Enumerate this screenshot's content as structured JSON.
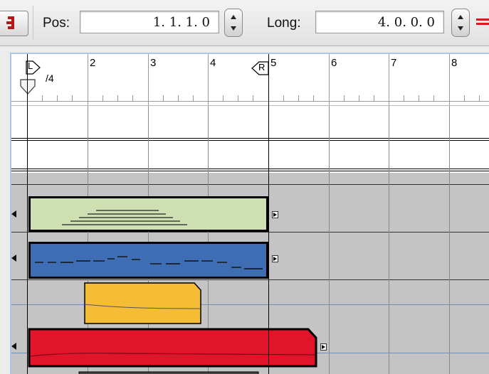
{
  "toolbar": {
    "pos_label": "Pos:",
    "pos_value": "1.  1.  1.    0",
    "long_label": "Long:",
    "long_value": "4.  0.  0.    0"
  },
  "ruler": {
    "signature": "/4",
    "left_locator": "L",
    "right_locator": "R",
    "bars": [
      "2",
      "3",
      "4",
      "5",
      "6",
      "7",
      "8"
    ]
  },
  "regions": [
    {
      "name": "midi-region-green",
      "color": "#cfe0b3"
    },
    {
      "name": "midi-region-blue",
      "color": "#3e6db3"
    },
    {
      "name": "midi-region-yellow",
      "color": "#f5bd35"
    },
    {
      "name": "midi-region-red",
      "color": "#e0152a"
    }
  ],
  "colors": {
    "selection_border": "#aac6ea",
    "grid_bg": "#c4c4c4",
    "lane_line": "#6f8fb5"
  }
}
